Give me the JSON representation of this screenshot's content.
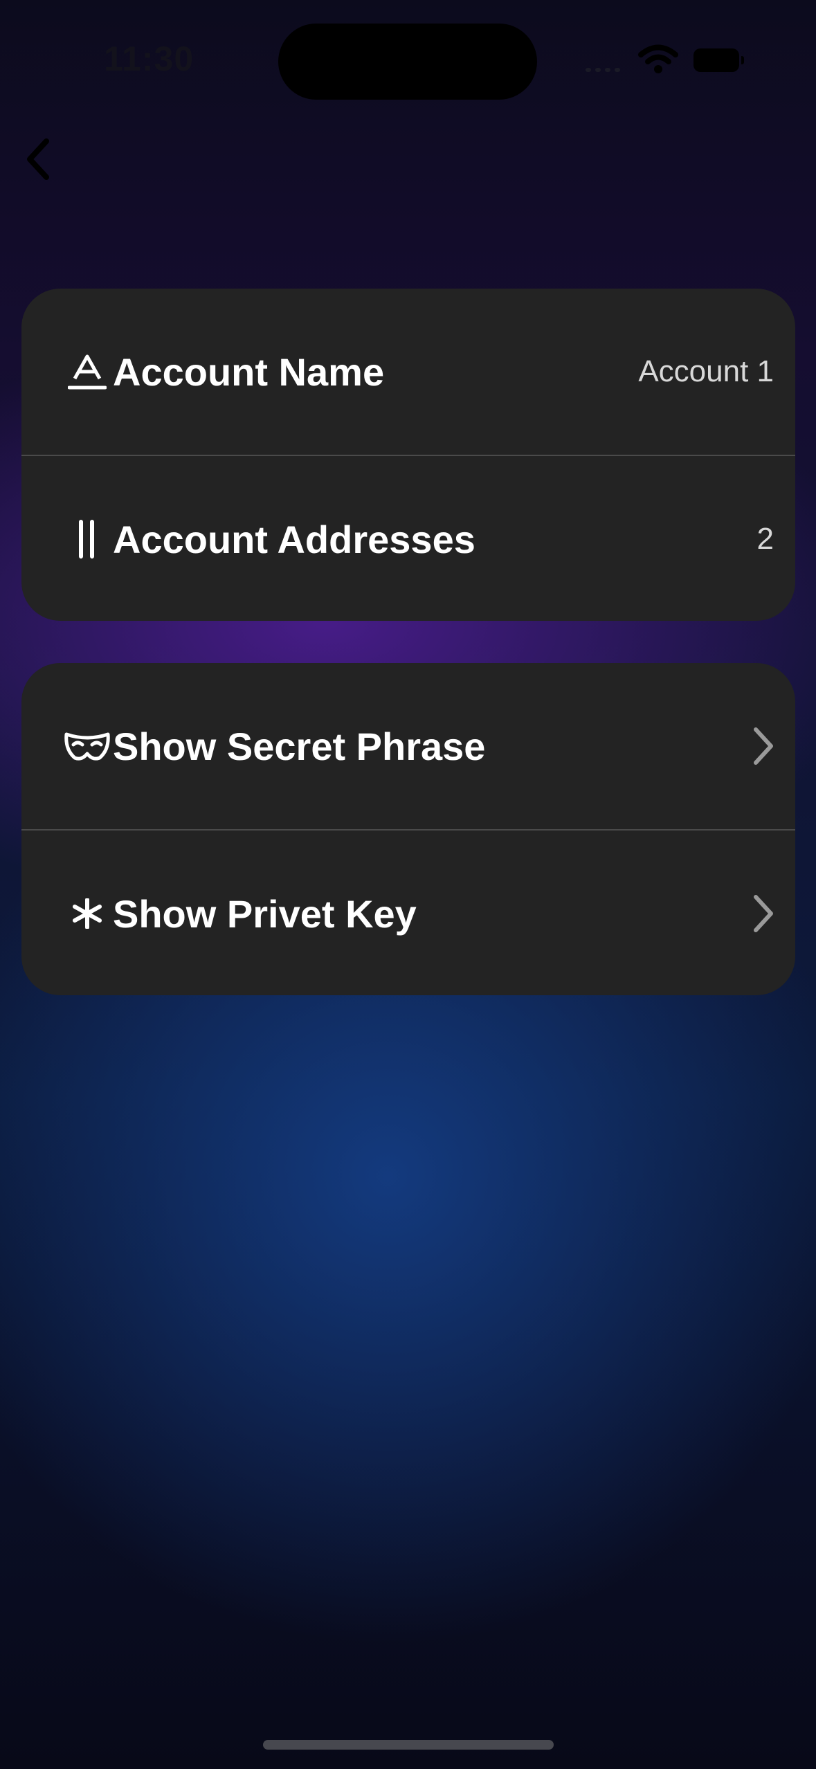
{
  "status_bar": {
    "time": "11:30"
  },
  "nav": {
    "back_icon": "chevron-left-icon"
  },
  "sections": [
    {
      "rows": [
        {
          "icon": "text-format-icon",
          "label": "Account Name",
          "value": "Account 1"
        },
        {
          "icon": "pause-bars-icon",
          "label": "Account Addresses",
          "value": "2"
        }
      ]
    },
    {
      "rows": [
        {
          "icon": "mask-icon",
          "label": "Show Secret Phrase",
          "accessory": "chevron-right-icon"
        },
        {
          "icon": "asterisk-icon",
          "label": "Show Privet Key",
          "accessory": "chevron-right-icon"
        }
      ]
    }
  ],
  "colors": {
    "card_background": "#232323",
    "separator": "#4a4a4a",
    "label_text": "#ffffff",
    "value_text": "#d8d8d8",
    "chevron": "#9a9a9a"
  }
}
